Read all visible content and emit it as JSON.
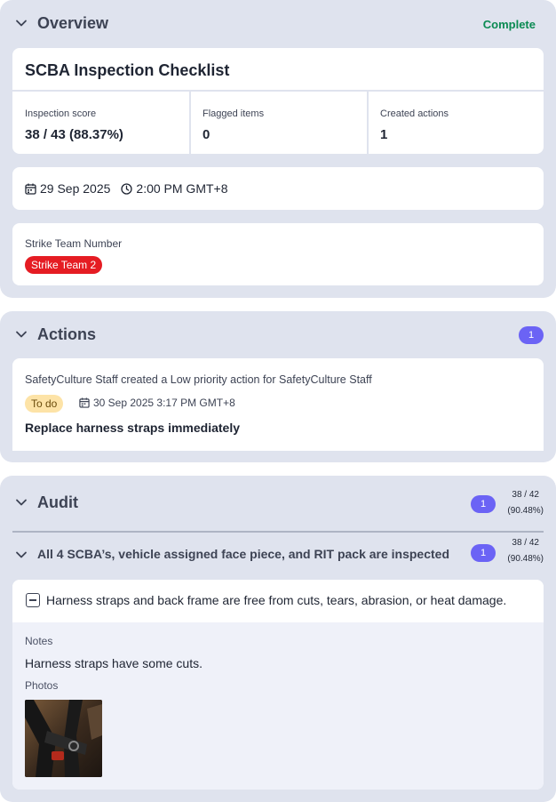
{
  "overview": {
    "title": "Overview",
    "status": "Complete",
    "inspection_title": "SCBA Inspection Checklist",
    "stats": [
      {
        "label": "Inspection score",
        "value": "38 / 43 (88.37%)"
      },
      {
        "label": "Flagged items",
        "value": "0"
      },
      {
        "label": "Created actions",
        "value": "1"
      }
    ],
    "date": "29 Sep 2025",
    "time": "2:00 PM GMT+8",
    "strike_label": "Strike Team Number",
    "strike_value": "Strike Team 2",
    "icons": {
      "date": "calendar-icon",
      "time": "clock-icon"
    },
    "colors": {
      "complete": "#0a8a52",
      "strike_pill": "#e51c23"
    }
  },
  "actions": {
    "title": "Actions",
    "count": "1",
    "item": {
      "description": "SafetyCulture Staff created a Low priority action for SafetyCulture Staff",
      "status": "To do",
      "due": "30 Sep 2025 3:17 PM GMT+8",
      "title": "Replace harness straps immediately"
    },
    "colors": {
      "badge": "#6b63f5",
      "todo_pill": "#fde3a7"
    }
  },
  "audit": {
    "title": "Audit",
    "count": "1",
    "score": "38 / 42",
    "percent": "(90.48%)",
    "subsection": {
      "title": "All 4 SCBA’s, vehicle assigned face piece, and RIT pack are inspected",
      "count": "1",
      "score": "38 / 42",
      "percent": "(90.48%)"
    },
    "item": {
      "question": "Harness straps and back frame are free from cuts, tears, abrasion, or heat damage.",
      "notes_label": "Notes",
      "notes": "Harness straps have some cuts.",
      "photos_label": "Photos"
    }
  }
}
